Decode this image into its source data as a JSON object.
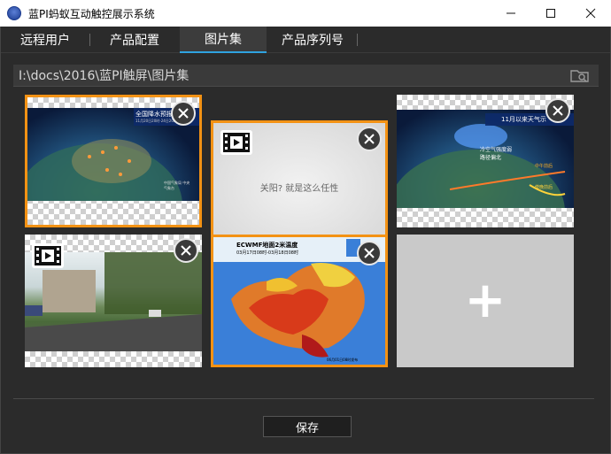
{
  "window": {
    "title": "蓝PI蚂蚁互动触控展示系统"
  },
  "tabs": [
    {
      "label": "远程用户"
    },
    {
      "label": "产品配置"
    },
    {
      "label": "图片集"
    },
    {
      "label": "产品序列号"
    }
  ],
  "active_tab": "图片集",
  "path": {
    "value": "I:\\docs\\2016\\蓝PI触屏\\图片集"
  },
  "gallery": {
    "items": [
      {
        "type": "image",
        "selected": true,
        "title": "全国降水预报",
        "caption": "11月20日20时-24日20时",
        "corner": "中国气象局 中央气象台"
      },
      {
        "type": "video",
        "selected": true,
        "caption": "关阳? 就是这么任性"
      },
      {
        "type": "image",
        "selected": false,
        "title": "11月以来天气示",
        "caption": "冷空气强度弱 路径偏北",
        "legend_a": "中午前后",
        "legend_b": "傍晚前后"
      },
      {
        "type": "video",
        "selected": false
      },
      {
        "type": "image",
        "selected": true,
        "title": "ECWMF地面2米温度",
        "caption": "03月17日08时-03月18日08时",
        "corner": "06月01日08时发布"
      }
    ],
    "add_label": "+"
  },
  "footer": {
    "save_label": "保存"
  },
  "colors": {
    "accent": "#2fa3e0",
    "selection": "#f39214",
    "background": "#2b2b2b"
  }
}
